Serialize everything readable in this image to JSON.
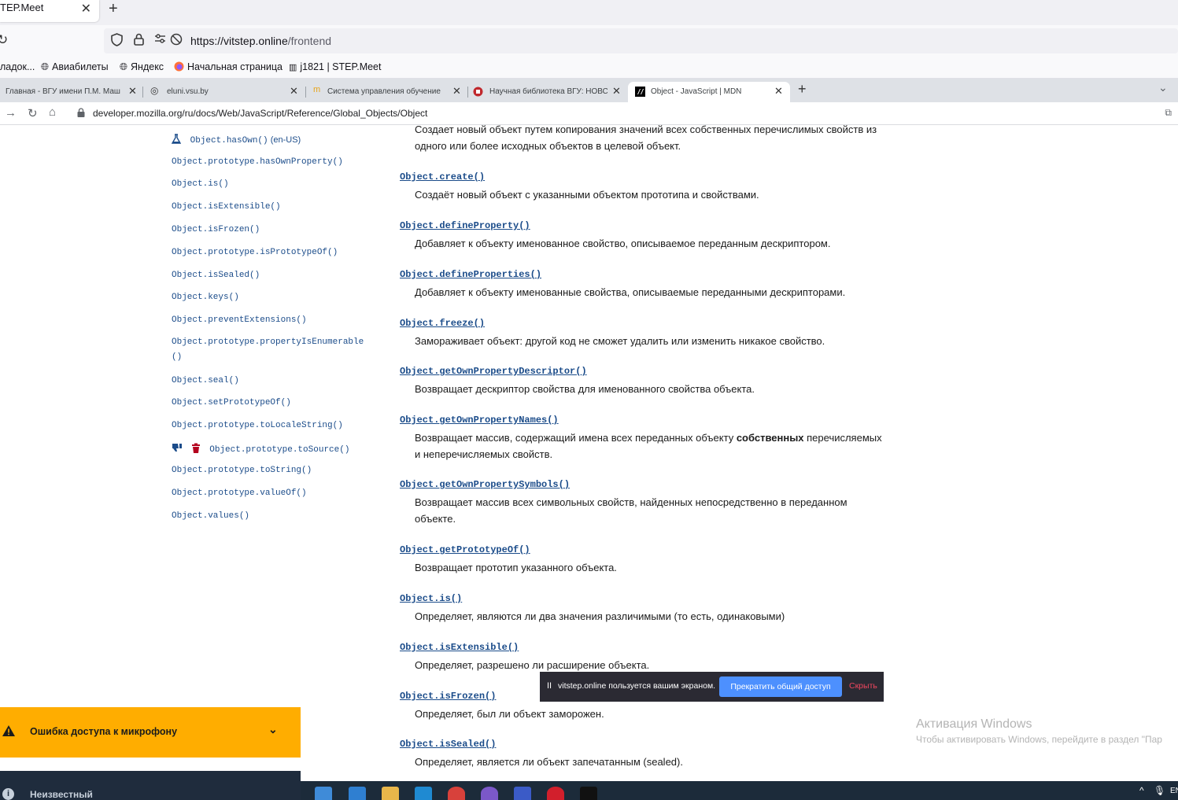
{
  "outer_browser": {
    "tab_title": "ТЕР.Meet",
    "tab_close": "✕",
    "new_tab": "+",
    "url_host": "https://vitstep.online",
    "url_path": "/frontend",
    "bookmarks": [
      {
        "label": "ладок...",
        "icon": "folder-icon"
      },
      {
        "label": "Авиабилеты",
        "icon": "globe-icon"
      },
      {
        "label": "Яндекс",
        "icon": "globe-icon"
      },
      {
        "label": "Начальная страница",
        "icon": "firefox-icon"
      },
      {
        "label": "j1821 | STEP.Meet",
        "icon": "step-icon"
      }
    ]
  },
  "inner_browser": {
    "tabs": [
      {
        "label": "Главная - ВГУ имени П.М. Маш",
        "active": false
      },
      {
        "label": "eluni.vsu.by",
        "active": false
      },
      {
        "label": "Система управления обучение",
        "active": false
      },
      {
        "label": "Научная библиотека ВГУ: НОВС",
        "active": false
      },
      {
        "label": "Object - JavaScript | MDN",
        "active": true
      }
    ],
    "new_tab": "+",
    "url": "developer.mozilla.org/ru/docs/Web/JavaScript/Reference/Global_Objects/Object"
  },
  "sidebar": {
    "items": [
      {
        "label": "Object.hasOwn()",
        "suffix": " (en-US)",
        "icon": "flask-icon"
      },
      {
        "label": "Object.prototype.hasOwnProperty()"
      },
      {
        "label": "Object.is()"
      },
      {
        "label": "Object.isExtensible()"
      },
      {
        "label": "Object.isFrozen()"
      },
      {
        "label": "Object.prototype.isPrototypeOf()"
      },
      {
        "label": "Object.isSealed()"
      },
      {
        "label": "Object.keys()"
      },
      {
        "label": "Object.preventExtensions()"
      },
      {
        "label": "Object.prototype.propertyIsEnumerable()"
      },
      {
        "label": "Object.seal()"
      },
      {
        "label": "Object.setPrototypeOf()"
      },
      {
        "label": "Object.prototype.toLocaleString()"
      },
      {
        "label": "Object.prototype.toSource()",
        "icon": "thumbs-down-trash-icon"
      },
      {
        "label": "Object.prototype.toString()"
      },
      {
        "label": "Object.prototype.valueOf()"
      },
      {
        "label": "Object.values()"
      }
    ]
  },
  "main": {
    "intro": "Создает новый объект путем копирования значений всех собственных перечислимых свойств из одного или более исходных объектов в целевой объект.",
    "methods": [
      {
        "name": "Object.create()",
        "desc": "Создаёт новый объект с указанными объектом прототипа и свойствами."
      },
      {
        "name": "Object.defineProperty()",
        "desc": "Добавляет к объекту именованное свойство, описываемое переданным дескриптором."
      },
      {
        "name": "Object.defineProperties()",
        "desc": "Добавляет к объекту именованные свойства, описываемые переданными дескрипторами."
      },
      {
        "name": "Object.freeze()",
        "desc": "Замораживает объект: другой код не сможет удалить или изменить никакое свойство."
      },
      {
        "name": "Object.getOwnPropertyDescriptor()",
        "desc": "Возвращает дескриптор свойства для именованного свойства объекта."
      },
      {
        "name": "Object.getOwnPropertyNames()",
        "desc_before": "Возвращает массив, содержащий имена всех переданных объекту ",
        "desc_bold": "собственных",
        "desc_after": " перечисляемых и неперечисляемых свойств."
      },
      {
        "name": "Object.getOwnPropertySymbols()",
        "desc": "Возвращает массив всех символьных свойств, найденных непосредственно в переданном объекте."
      },
      {
        "name": "Object.getPrototypeOf()",
        "desc": "Возвращает прототип указанного объекта."
      },
      {
        "name": "Object.is()",
        "desc": "Определяет, являются ли два значения различимыми (то есть, одинаковыми)"
      },
      {
        "name": "Object.isExtensible()",
        "desc": "Определяет, разрешено ли расширение объекта."
      },
      {
        "name": "Object.isFrozen()",
        "desc": "Определяет, был ли объект заморожен."
      },
      {
        "name": "Object.isSealed()",
        "desc": "Определяет, является ли объект запечатанным (sealed)."
      }
    ]
  },
  "share_bar": {
    "pause": "II",
    "message": "vitstep.online пользуется вашим экраном.",
    "stop_button": "Прекратить общий доступ",
    "hide_button": "Скрыть"
  },
  "watermark": {
    "title": "Активация Windows",
    "subtitle": "Чтобы активировать Windows, перейдите в раздел \"Пар"
  },
  "mic_toast": {
    "text": "Ошибка доступа к микрофону",
    "chevron": "⌄"
  },
  "user_strip": {
    "info": "i",
    "name": "Неизвестный"
  },
  "taskbar": {
    "icons": [
      "windows-store-icon",
      "mail-icon",
      "file-explorer-icon",
      "vscode-icon",
      "chrome-icon",
      "viber-icon",
      "save-icon",
      "opera-icon",
      "terminal-icon"
    ],
    "tray_up": "^",
    "lang": "EN"
  },
  "colors": {
    "link": "#1b4c8a",
    "toast": "#ffad00",
    "share_button": "#4d90fe",
    "taskbar": "#1c2b3a"
  }
}
